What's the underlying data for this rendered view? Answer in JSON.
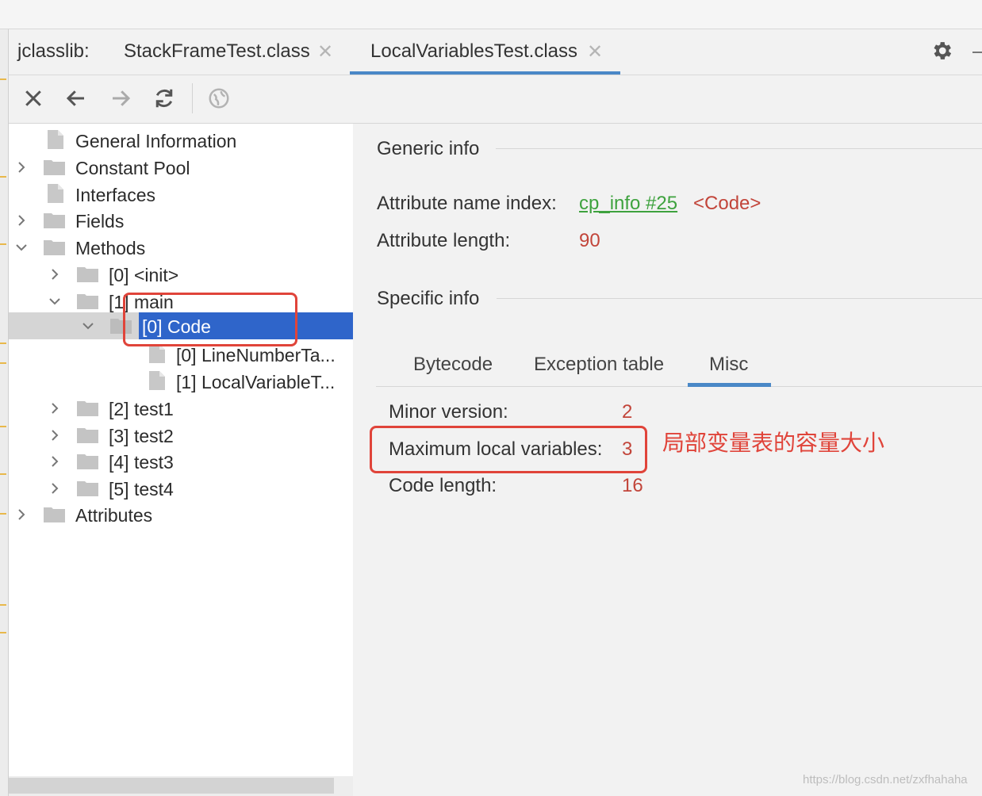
{
  "tabs": {
    "prefix": "jclasslib:",
    "items": [
      {
        "label": "StackFrameTest.class",
        "active": false
      },
      {
        "label": "LocalVariablesTest.class",
        "active": true
      }
    ],
    "close_glyph": "✕"
  },
  "toolbar": {
    "icons": [
      "close-icon",
      "back-arrow-icon",
      "forward-arrow-icon",
      "refresh-icon",
      "web-globe-icon"
    ]
  },
  "tree": {
    "items": [
      {
        "label": "General Information"
      },
      {
        "label": "Constant Pool"
      },
      {
        "label": "Interfaces"
      },
      {
        "label": "Fields"
      },
      {
        "label": "Methods"
      },
      {
        "label": "[0] <init>"
      },
      {
        "label": "[1] main"
      },
      {
        "label": "[0] Code",
        "selected": true
      },
      {
        "label": "[0] LineNumberTa..."
      },
      {
        "label": "[1] LocalVariableT..."
      },
      {
        "label": "[2] test1"
      },
      {
        "label": "[3] test2"
      },
      {
        "label": "[4] test3"
      },
      {
        "label": "[5] test4"
      },
      {
        "label": "Attributes"
      }
    ]
  },
  "generic_info": {
    "title": "Generic info",
    "attribute_name_index_label": "Attribute name index:",
    "attribute_name_index_link": "cp_info #25",
    "attribute_name_index_value": "<Code>",
    "attribute_length_label": "Attribute length:",
    "attribute_length_value": "90"
  },
  "specific_info": {
    "title": "Specific info",
    "tabs": [
      {
        "label": "Bytecode",
        "active": false
      },
      {
        "label": "Exception table",
        "active": false
      },
      {
        "label": "Misc",
        "active": true
      }
    ],
    "minor_version_label": "Minor version:",
    "minor_version_value": "2",
    "max_locals_label": "Maximum local variables:",
    "max_locals_value": "3",
    "code_length_label": "Code length:",
    "code_length_value": "16"
  },
  "annotation": {
    "text": "局部变量表的容量大小"
  },
  "watermark": "https://blog.csdn.net/zxfhahaha",
  "colors": {
    "accent": "#4a88c7",
    "selection": "#2f65ca",
    "value_red": "#c2453a",
    "link_green": "#3ea23e",
    "annotation_red": "#e0443a"
  }
}
